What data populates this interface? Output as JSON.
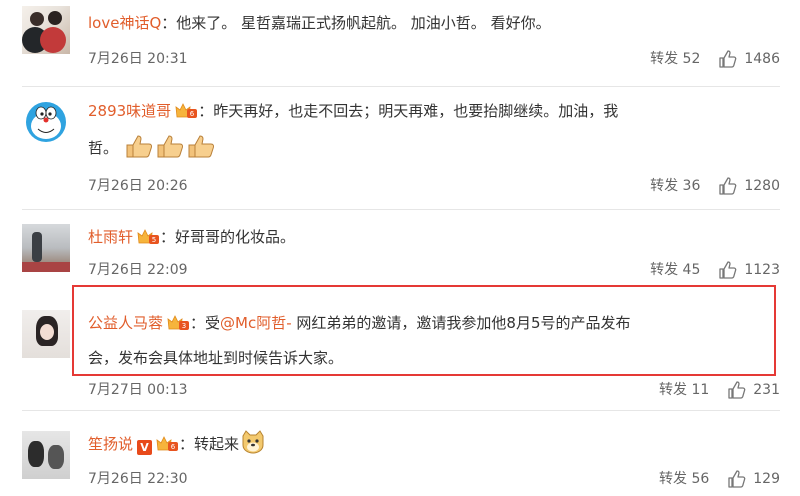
{
  "comments": [
    {
      "username": "love神话Q",
      "text": "：他来了。 星哲嘉瑞正式扬帆起航。 加油小哲。 看好你。",
      "time": "7月26日 20:31",
      "repost": "转发 52",
      "likes": "1486"
    },
    {
      "username": "2893味道哥",
      "text_line1": "：昨天再好，也走不回去；明天再难，也要抬脚继续。加油，我",
      "text_line2": "哲。",
      "time": "7月26日 20:26",
      "repost": "转发 36",
      "likes": "1280"
    },
    {
      "username": "杜雨轩",
      "text": "：好哥哥的化妆品。",
      "time": "7月26日 22:09",
      "repost": "转发 45",
      "likes": "1123"
    },
    {
      "username": "公益人马蓉",
      "text_prefix": "：受",
      "mention": "@Mc阿哲-",
      "text_line1_rest": " 网红弟弟的邀请，邀请我参加他8月5号的产品发布",
      "text_line2": "会，发布会具体地址到时候告诉大家。",
      "time": "7月27日 00:13",
      "repost": "转发 11",
      "likes": "231"
    },
    {
      "username": "笙扬说",
      "vip_badge": "V",
      "text": "：转起来",
      "time": "7月26日 22:30",
      "repost": "转发 56",
      "likes": "129"
    }
  ],
  "colors": {
    "username": "#e15e2c",
    "highlight": "#e53935",
    "divider": "#e6e6e6"
  },
  "icons": [
    "vip-crown-badge-icon",
    "thumbs-up-emoji-icon",
    "doge-emoji-icon",
    "like-thumb-icon"
  ]
}
